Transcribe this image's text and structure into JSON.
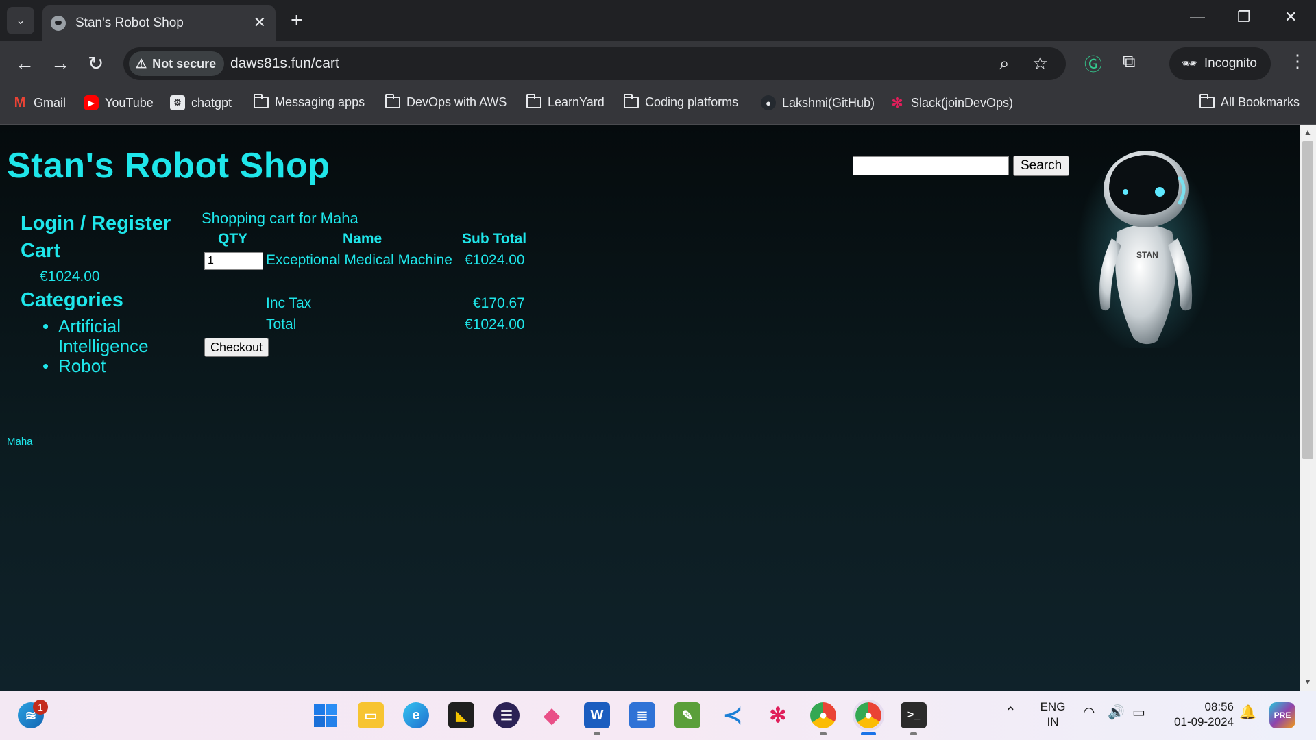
{
  "browser": {
    "tab_title": "Stan's Robot Shop",
    "security_label": "Not secure",
    "url": "daws81s.fun/cart",
    "profile_label": "Incognito",
    "bookmarks": [
      {
        "label": "Gmail",
        "icon": "gmail-icon"
      },
      {
        "label": "YouTube",
        "icon": "youtube-icon"
      },
      {
        "label": "chatgpt",
        "icon": "chatgpt-icon"
      },
      {
        "label": "Messaging apps",
        "icon": "folder-icon"
      },
      {
        "label": "DevOps with AWS",
        "icon": "folder-icon"
      },
      {
        "label": "LearnYard",
        "icon": "folder-icon"
      },
      {
        "label": "Coding platforms",
        "icon": "folder-icon"
      },
      {
        "label": "Lakshmi(GitHub)",
        "icon": "github-icon"
      },
      {
        "label": "Slack(joinDevOps)",
        "icon": "slack-icon"
      }
    ],
    "all_bookmarks_label": "All Bookmarks"
  },
  "page": {
    "site_title": "Stan's Robot Shop",
    "search_button": "Search",
    "search_value": "",
    "nav": {
      "login_register": "Login / Register",
      "cart": "Cart",
      "cart_amount": "€1024.00",
      "categories": "Categories",
      "category_items": [
        "Artificial Intelligence",
        "Robot"
      ]
    },
    "cart": {
      "heading": "Shopping cart for Maha",
      "columns": {
        "qty": "QTY",
        "name": "Name",
        "subtotal": "Sub Total"
      },
      "items": [
        {
          "qty": "1",
          "name": "Exceptional Medical Machine",
          "subtotal": "€1024.00"
        }
      ],
      "tax_label": "Inc Tax",
      "tax_value": "€170.67",
      "total_label": "Total",
      "total_value": "€1024.00",
      "checkout_button": "Checkout"
    },
    "robot_label": "STAN",
    "footer_user": "Maha",
    "accent_color": "#1fe6ea"
  },
  "taskbar": {
    "notification_count": "1",
    "language": "ENG",
    "region": "IN",
    "time": "08:56",
    "date": "01-09-2024"
  }
}
